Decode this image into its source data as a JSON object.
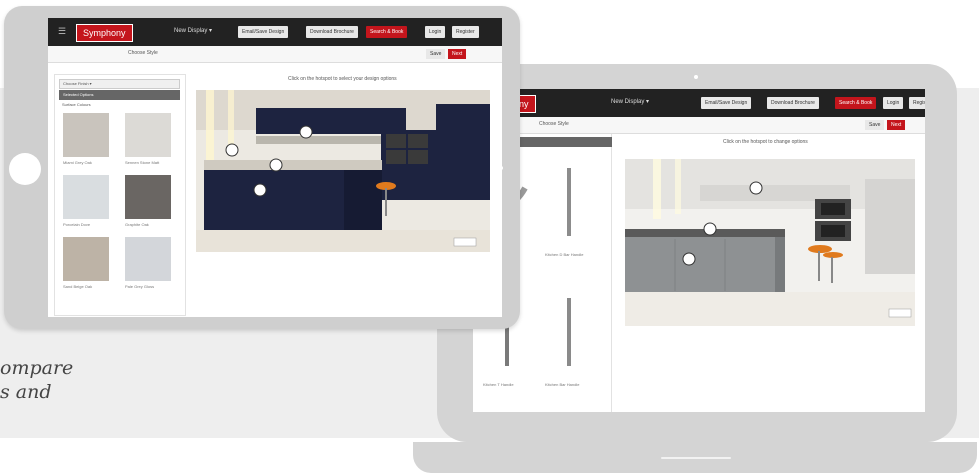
{
  "tagline": {
    "line1": "ompare",
    "line2": "s and"
  },
  "app": {
    "logo": "Symphony",
    "menu_label": "New Display ▾",
    "top_buttons": [
      "Email/Save Design",
      "Download Brochure",
      "Search & Book"
    ],
    "top_small": [
      "Login",
      "Register"
    ],
    "sub_tab": "Choose Style",
    "save_btn": "Save",
    "next_btn": "Next",
    "tablet_instruction": "Click on the hotspot to select your design options",
    "laptop_instruction": "Click on the hotspot to change options",
    "filter_1": "Choose Finish ▾",
    "filter_2": "Selected Options",
    "filter_3": "Surface Colours",
    "view_btn": "Full view"
  },
  "tablet_swatches": [
    {
      "caption": "Miami Grey Oak",
      "color": "#c9c4bd"
    },
    {
      "caption": "Sennen Stone Matt",
      "color": "#dcdad6"
    },
    {
      "caption": "Porcelain Dove",
      "color": "#d9dde0"
    },
    {
      "caption": "Graphite Oak",
      "color": "#6a6663"
    },
    {
      "caption": "Sand Beige Oak",
      "color": "#bdb3a6"
    },
    {
      "caption": "Pale Grey Gloss",
      "color": "#d3d6da"
    }
  ],
  "laptop_handles": [
    {
      "caption": "Kitchen Cup Handle",
      "color": "#9a9a9a"
    },
    {
      "caption": "Kitchen D Bar Handle",
      "color": "#8c8c8c"
    },
    {
      "caption": "Kitchen T Handle",
      "color": "#7a7a7a"
    },
    {
      "caption": "Kitchen Bar Handle",
      "color": "#8a8a8a"
    }
  ],
  "colors": {
    "brand_red": "#c4151c",
    "topbar": "#222222",
    "device_grey": "#d4d4d4",
    "navy_cabinets": "#1d2340",
    "grey_cabinets": "#8e9193"
  }
}
